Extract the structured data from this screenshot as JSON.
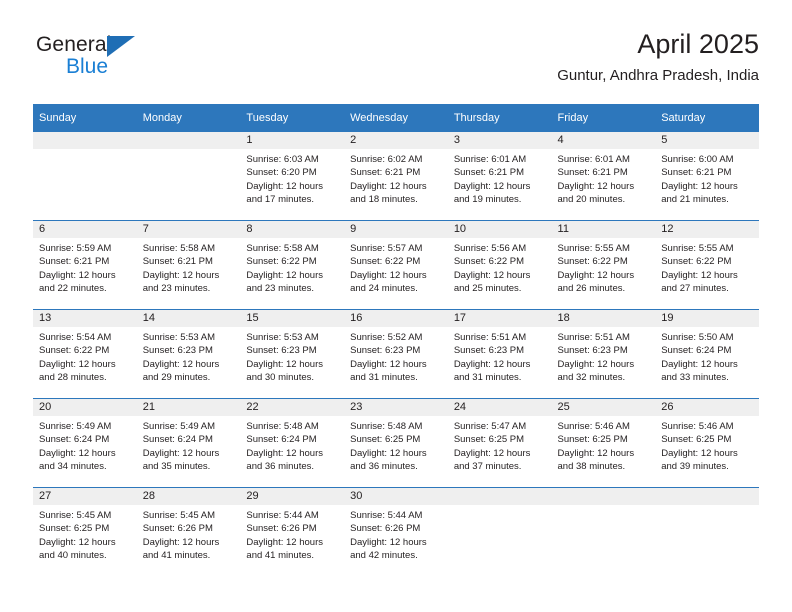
{
  "brand": {
    "name_part1": "General",
    "name_part2": "Blue",
    "triangle_color": "#1f6eb5",
    "blue_color": "#1a7fd4"
  },
  "header": {
    "title": "April 2025",
    "subtitle": "Guntur, Andhra Pradesh, India"
  },
  "theme": {
    "header_bg": "#2d77bc",
    "daynum_bg": "#efefef",
    "row_border": "#2d77bc",
    "text": "#231f20"
  },
  "weekday_headers": [
    "Sunday",
    "Monday",
    "Tuesday",
    "Wednesday",
    "Thursday",
    "Friday",
    "Saturday"
  ],
  "weeks": [
    [
      {
        "day": "",
        "sunrise": "",
        "sunset": "",
        "daylight_line1": "",
        "daylight_line2": ""
      },
      {
        "day": "",
        "sunrise": "",
        "sunset": "",
        "daylight_line1": "",
        "daylight_line2": ""
      },
      {
        "day": "1",
        "sunrise": "Sunrise: 6:03 AM",
        "sunset": "Sunset: 6:20 PM",
        "daylight_line1": "Daylight: 12 hours",
        "daylight_line2": "and 17 minutes."
      },
      {
        "day": "2",
        "sunrise": "Sunrise: 6:02 AM",
        "sunset": "Sunset: 6:21 PM",
        "daylight_line1": "Daylight: 12 hours",
        "daylight_line2": "and 18 minutes."
      },
      {
        "day": "3",
        "sunrise": "Sunrise: 6:01 AM",
        "sunset": "Sunset: 6:21 PM",
        "daylight_line1": "Daylight: 12 hours",
        "daylight_line2": "and 19 minutes."
      },
      {
        "day": "4",
        "sunrise": "Sunrise: 6:01 AM",
        "sunset": "Sunset: 6:21 PM",
        "daylight_line1": "Daylight: 12 hours",
        "daylight_line2": "and 20 minutes."
      },
      {
        "day": "5",
        "sunrise": "Sunrise: 6:00 AM",
        "sunset": "Sunset: 6:21 PM",
        "daylight_line1": "Daylight: 12 hours",
        "daylight_line2": "and 21 minutes."
      }
    ],
    [
      {
        "day": "6",
        "sunrise": "Sunrise: 5:59 AM",
        "sunset": "Sunset: 6:21 PM",
        "daylight_line1": "Daylight: 12 hours",
        "daylight_line2": "and 22 minutes."
      },
      {
        "day": "7",
        "sunrise": "Sunrise: 5:58 AM",
        "sunset": "Sunset: 6:21 PM",
        "daylight_line1": "Daylight: 12 hours",
        "daylight_line2": "and 23 minutes."
      },
      {
        "day": "8",
        "sunrise": "Sunrise: 5:58 AM",
        "sunset": "Sunset: 6:22 PM",
        "daylight_line1": "Daylight: 12 hours",
        "daylight_line2": "and 23 minutes."
      },
      {
        "day": "9",
        "sunrise": "Sunrise: 5:57 AM",
        "sunset": "Sunset: 6:22 PM",
        "daylight_line1": "Daylight: 12 hours",
        "daylight_line2": "and 24 minutes."
      },
      {
        "day": "10",
        "sunrise": "Sunrise: 5:56 AM",
        "sunset": "Sunset: 6:22 PM",
        "daylight_line1": "Daylight: 12 hours",
        "daylight_line2": "and 25 minutes."
      },
      {
        "day": "11",
        "sunrise": "Sunrise: 5:55 AM",
        "sunset": "Sunset: 6:22 PM",
        "daylight_line1": "Daylight: 12 hours",
        "daylight_line2": "and 26 minutes."
      },
      {
        "day": "12",
        "sunrise": "Sunrise: 5:55 AM",
        "sunset": "Sunset: 6:22 PM",
        "daylight_line1": "Daylight: 12 hours",
        "daylight_line2": "and 27 minutes."
      }
    ],
    [
      {
        "day": "13",
        "sunrise": "Sunrise: 5:54 AM",
        "sunset": "Sunset: 6:22 PM",
        "daylight_line1": "Daylight: 12 hours",
        "daylight_line2": "and 28 minutes."
      },
      {
        "day": "14",
        "sunrise": "Sunrise: 5:53 AM",
        "sunset": "Sunset: 6:23 PM",
        "daylight_line1": "Daylight: 12 hours",
        "daylight_line2": "and 29 minutes."
      },
      {
        "day": "15",
        "sunrise": "Sunrise: 5:53 AM",
        "sunset": "Sunset: 6:23 PM",
        "daylight_line1": "Daylight: 12 hours",
        "daylight_line2": "and 30 minutes."
      },
      {
        "day": "16",
        "sunrise": "Sunrise: 5:52 AM",
        "sunset": "Sunset: 6:23 PM",
        "daylight_line1": "Daylight: 12 hours",
        "daylight_line2": "and 31 minutes."
      },
      {
        "day": "17",
        "sunrise": "Sunrise: 5:51 AM",
        "sunset": "Sunset: 6:23 PM",
        "daylight_line1": "Daylight: 12 hours",
        "daylight_line2": "and 31 minutes."
      },
      {
        "day": "18",
        "sunrise": "Sunrise: 5:51 AM",
        "sunset": "Sunset: 6:23 PM",
        "daylight_line1": "Daylight: 12 hours",
        "daylight_line2": "and 32 minutes."
      },
      {
        "day": "19",
        "sunrise": "Sunrise: 5:50 AM",
        "sunset": "Sunset: 6:24 PM",
        "daylight_line1": "Daylight: 12 hours",
        "daylight_line2": "and 33 minutes."
      }
    ],
    [
      {
        "day": "20",
        "sunrise": "Sunrise: 5:49 AM",
        "sunset": "Sunset: 6:24 PM",
        "daylight_line1": "Daylight: 12 hours",
        "daylight_line2": "and 34 minutes."
      },
      {
        "day": "21",
        "sunrise": "Sunrise: 5:49 AM",
        "sunset": "Sunset: 6:24 PM",
        "daylight_line1": "Daylight: 12 hours",
        "daylight_line2": "and 35 minutes."
      },
      {
        "day": "22",
        "sunrise": "Sunrise: 5:48 AM",
        "sunset": "Sunset: 6:24 PM",
        "daylight_line1": "Daylight: 12 hours",
        "daylight_line2": "and 36 minutes."
      },
      {
        "day": "23",
        "sunrise": "Sunrise: 5:48 AM",
        "sunset": "Sunset: 6:25 PM",
        "daylight_line1": "Daylight: 12 hours",
        "daylight_line2": "and 36 minutes."
      },
      {
        "day": "24",
        "sunrise": "Sunrise: 5:47 AM",
        "sunset": "Sunset: 6:25 PM",
        "daylight_line1": "Daylight: 12 hours",
        "daylight_line2": "and 37 minutes."
      },
      {
        "day": "25",
        "sunrise": "Sunrise: 5:46 AM",
        "sunset": "Sunset: 6:25 PM",
        "daylight_line1": "Daylight: 12 hours",
        "daylight_line2": "and 38 minutes."
      },
      {
        "day": "26",
        "sunrise": "Sunrise: 5:46 AM",
        "sunset": "Sunset: 6:25 PM",
        "daylight_line1": "Daylight: 12 hours",
        "daylight_line2": "and 39 minutes."
      }
    ],
    [
      {
        "day": "27",
        "sunrise": "Sunrise: 5:45 AM",
        "sunset": "Sunset: 6:25 PM",
        "daylight_line1": "Daylight: 12 hours",
        "daylight_line2": "and 40 minutes."
      },
      {
        "day": "28",
        "sunrise": "Sunrise: 5:45 AM",
        "sunset": "Sunset: 6:26 PM",
        "daylight_line1": "Daylight: 12 hours",
        "daylight_line2": "and 41 minutes."
      },
      {
        "day": "29",
        "sunrise": "Sunrise: 5:44 AM",
        "sunset": "Sunset: 6:26 PM",
        "daylight_line1": "Daylight: 12 hours",
        "daylight_line2": "and 41 minutes."
      },
      {
        "day": "30",
        "sunrise": "Sunrise: 5:44 AM",
        "sunset": "Sunset: 6:26 PM",
        "daylight_line1": "Daylight: 12 hours",
        "daylight_line2": "and 42 minutes."
      },
      {
        "day": "",
        "sunrise": "",
        "sunset": "",
        "daylight_line1": "",
        "daylight_line2": ""
      },
      {
        "day": "",
        "sunrise": "",
        "sunset": "",
        "daylight_line1": "",
        "daylight_line2": ""
      },
      {
        "day": "",
        "sunrise": "",
        "sunset": "",
        "daylight_line1": "",
        "daylight_line2": ""
      }
    ]
  ]
}
